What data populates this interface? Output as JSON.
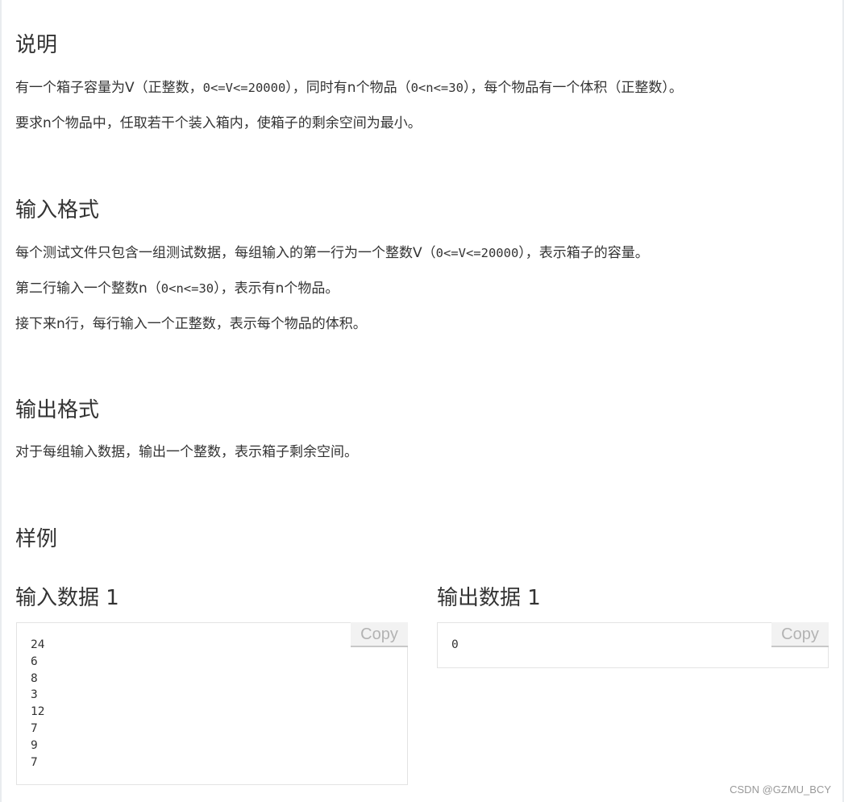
{
  "description": {
    "title": "说明",
    "line1_a": "有一个箱子容量为V（正整数，",
    "line1_code1": "0<=V<=20000",
    "line1_b": "），同时有n个物品（",
    "line1_code2": "0<n<=30",
    "line1_c": "），每个物品有一个体积（正整数）。",
    "line2": "要求n个物品中，任取若干个装入箱内，使箱子的剩余空间为最小。"
  },
  "input_format": {
    "title": "输入格式",
    "line1_a": "每个测试文件只包含一组测试数据，每组输入的第一行为一个整数V（",
    "line1_code": "0<=V<=20000",
    "line1_b": "），表示箱子的容量。",
    "line2_a": "第二行输入一个整数n（",
    "line2_code": "0<n<=30",
    "line2_b": "），表示有n个物品。",
    "line3": "接下来n行，每行输入一个正整数，表示每个物品的体积。"
  },
  "output_format": {
    "title": "输出格式",
    "line1": "对于每组输入数据，输出一个整数，表示箱子剩余空间。"
  },
  "samples": {
    "title": "样例",
    "input_title": "输入数据 1",
    "input_text": "24\n6\n8\n3\n12\n7\n9\n7",
    "output_title": "输出数据 1",
    "output_text": "0",
    "copy_label": "Copy"
  },
  "watermark": "CSDN @GZMU_BCY"
}
